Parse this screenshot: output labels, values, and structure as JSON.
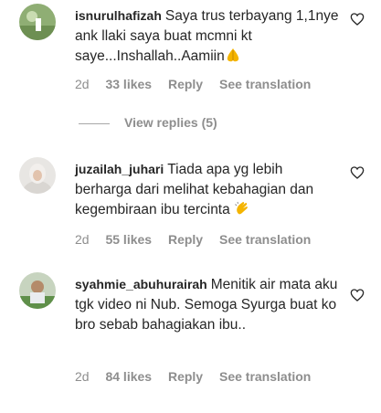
{
  "comments": [
    {
      "username": "isnurulhafizah",
      "text": "Saya trus terbayang 1,1nye ank llaki saya buat mcmni kt saye...Inshallah..Aamiin",
      "emoji": "praying-hands-emoji",
      "age": "2d",
      "likes": "33 likes",
      "reply": "Reply",
      "translate": "See translation",
      "view_replies": "View replies (5)"
    },
    {
      "username": "juzailah_juhari",
      "text": "Tiada apa yg lebih berharga dari melihat kebahagian dan kegembiraan ibu tercinta",
      "emoji": "clapping-hands-emoji",
      "age": "2d",
      "likes": "55 likes",
      "reply": "Reply",
      "translate": "See translation"
    },
    {
      "username": "syahmie_abuhurairah",
      "text": "Menitik air mata aku tgk video ni Nub. Semoga Syurga buat ko bro sebab bahagiakan ibu..",
      "age": "2d",
      "likes": "84 likes",
      "reply": "Reply",
      "translate": "See translation"
    }
  ],
  "colors": {
    "text": "#262626",
    "secondary": "#8e8e8e",
    "emoji": "#f4b400"
  },
  "icons": {
    "like": "heart-outline-icon"
  }
}
